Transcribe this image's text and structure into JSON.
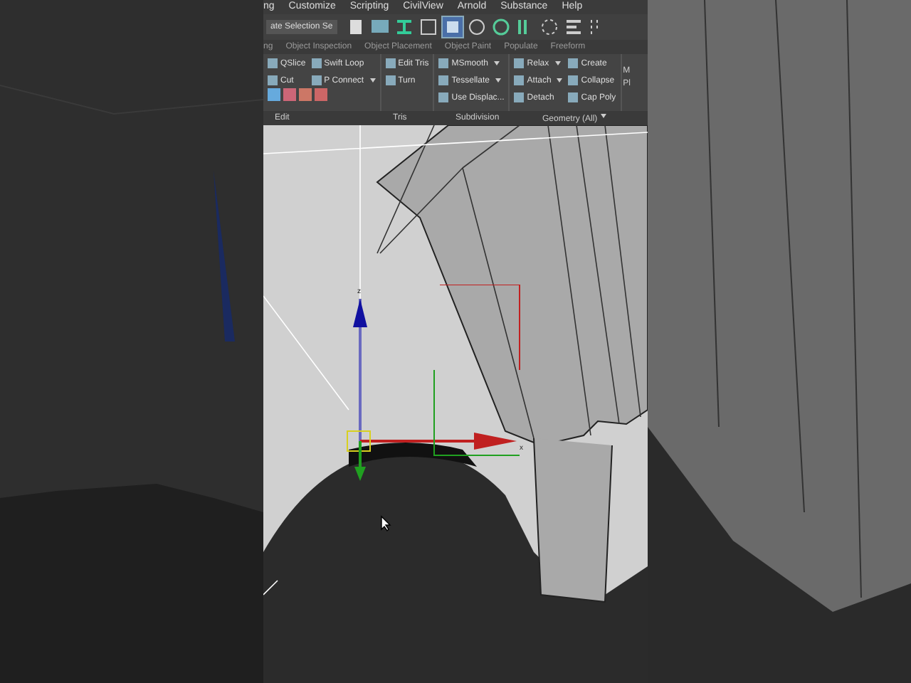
{
  "menu_bar": {
    "items": [
      "ng",
      "Customize",
      "Scripting",
      "CivilView",
      "Arnold",
      "Substance",
      "Help"
    ]
  },
  "main_toolbar": {
    "selection_set": "ate Selection Se",
    "buttons": [
      {
        "selected": false
      },
      {
        "selected": false
      },
      {
        "selected": false
      },
      {
        "selected": false
      },
      {
        "selected": true
      },
      {
        "selected": false
      },
      {
        "selected": false
      },
      {
        "selected": false
      },
      {
        "selected": false
      },
      {
        "selected": false
      },
      {
        "selected": false
      }
    ]
  },
  "ribbon_tabs": [
    "ng",
    "Object Inspection",
    "Object Placement",
    "Object Paint",
    "Populate",
    "Freeform"
  ],
  "ribbon_groups": [
    {
      "label": "Edit",
      "has_menu": false,
      "columns": [
        [
          {
            "label": "QSlice",
            "has_menu": false
          },
          {
            "label": "Cut",
            "has_menu": false
          }
        ],
        [
          {
            "label": "Swift Loop",
            "has_menu": false
          },
          {
            "label": "P Connect",
            "has_menu": true
          }
        ]
      ],
      "icon_row": true
    },
    {
      "label": "Tris",
      "has_menu": false,
      "columns": [
        [
          {
            "label": "Edit Tris",
            "has_menu": false
          },
          {
            "label": "Turn",
            "has_menu": false
          }
        ]
      ],
      "icon_row": false
    },
    {
      "label": "Subdivision",
      "has_menu": false,
      "columns": [
        [
          {
            "label": "MSmooth",
            "has_menu": true
          },
          {
            "label": "Tessellate",
            "has_menu": true
          },
          {
            "label": "Use Displac...",
            "has_menu": false
          }
        ]
      ],
      "icon_row": false
    },
    {
      "label": "Geometry (All)",
      "has_menu": true,
      "columns": [
        [
          {
            "label": "Relax",
            "has_menu": true
          },
          {
            "label": "Attach",
            "has_menu": true
          },
          {
            "label": "Detach",
            "has_menu": false
          }
        ],
        [
          {
            "label": "Create",
            "has_menu": false
          },
          {
            "label": "Collapse",
            "has_menu": false
          },
          {
            "label": "Cap Poly",
            "has_menu": false
          }
        ]
      ],
      "icon_row": false
    }
  ],
  "ribbon_cut_items": [
    "M",
    "Pl"
  ],
  "viewport": {
    "gizmo_labels": [
      "z",
      "x"
    ]
  }
}
